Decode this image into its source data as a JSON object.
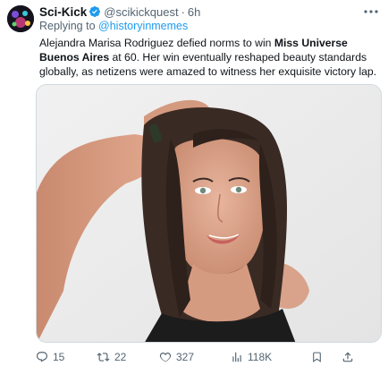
{
  "author": {
    "name": "Sci-Kick",
    "handle": "@scikickquest",
    "separator": "·",
    "time": "6h"
  },
  "reply": {
    "prefix": "Replying to",
    "mention": "@historyinmemes"
  },
  "text": {
    "part1": "Alejandra Marisa Rodriguez defied norms to win ",
    "bold": "Miss Universe Buenos Aires",
    "part2": " at 60. Her win eventually reshaped beauty standards globally, as netizens were amazed to witness her exquisite victory lap."
  },
  "stats": {
    "replies": "15",
    "retweets": "22",
    "likes": "327",
    "views": "118K"
  },
  "icons": {
    "verified": "verified-badge-icon",
    "more": "more-dots-icon",
    "reply": "reply-icon",
    "retweet": "retweet-icon",
    "like": "heart-icon",
    "views": "views-bar-icon",
    "bookmark": "bookmark-icon",
    "share": "share-icon"
  },
  "colors": {
    "accent": "#1d9bf0",
    "text": "#0f1419",
    "muted": "#536471"
  }
}
